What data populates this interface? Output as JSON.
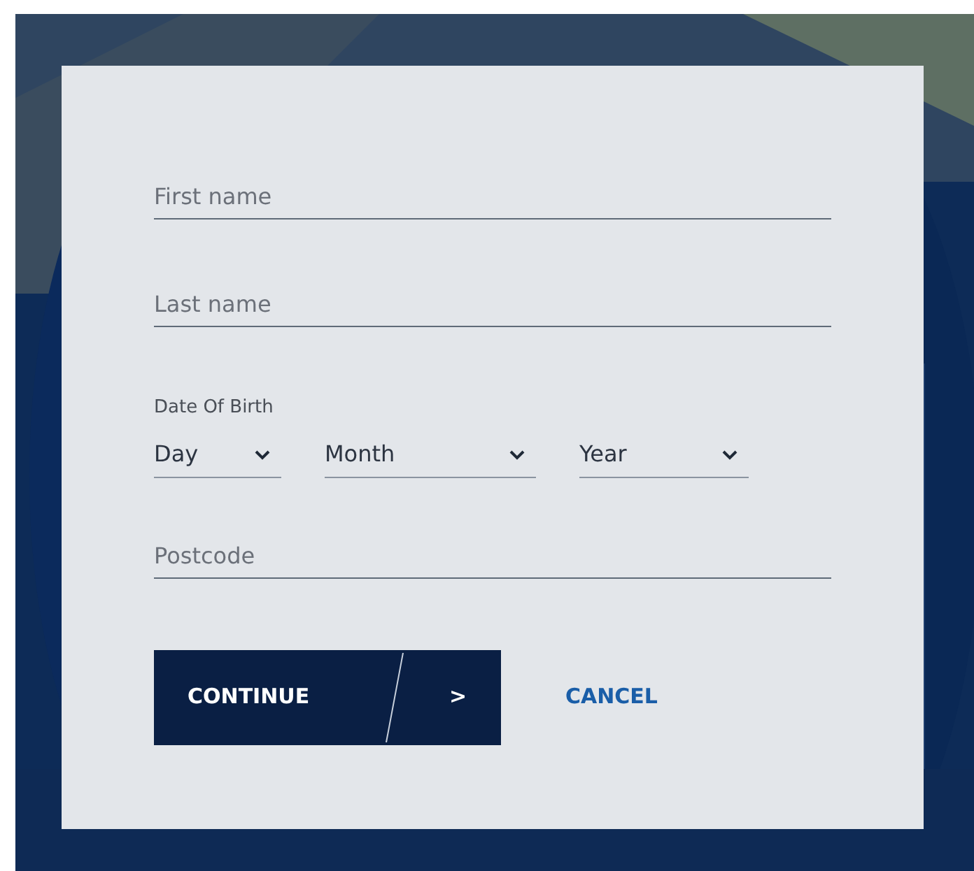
{
  "form": {
    "name_fields": [
      {
        "placeholder": "First name"
      },
      {
        "placeholder": "Last name"
      }
    ],
    "date_of_birth": {
      "label": "Date Of Birth",
      "selects": [
        {
          "value": "Day"
        },
        {
          "value": "Month"
        },
        {
          "value": "Year"
        }
      ]
    },
    "postcode": {
      "placeholder": "Postcode"
    },
    "continue_button": {
      "label": "CONTINUE",
      "arrow": ">"
    },
    "cancel_link": {
      "label": "CANCEL"
    }
  }
}
